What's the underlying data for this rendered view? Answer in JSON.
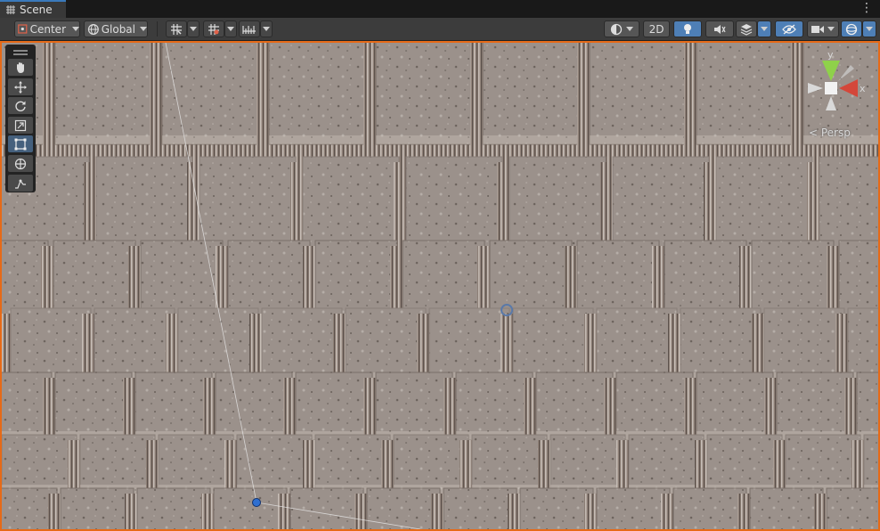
{
  "window": {
    "tab_title": "Scene",
    "menu_icon": "kebab-icon"
  },
  "toolbar": {
    "pivot_label": "Center",
    "space_label": "Global",
    "mode_2d_label": "2D",
    "icons": [
      "center-pivot-icon",
      "global-space-icon",
      "grid-snap-icon",
      "increment-snap-icon",
      "ruler-icon",
      "shading-mode-icon",
      "lighting-icon",
      "audio-mute-icon",
      "effects-icon",
      "hidden-objects-icon",
      "camera-icon",
      "gizmos-icon"
    ]
  },
  "tools": [
    "view-tool",
    "move-tool",
    "rotate-tool",
    "scale-tool",
    "rect-tool",
    "transform-tool",
    "custom-editor-tool"
  ],
  "gizmo": {
    "x_label": "x",
    "y_label": "y",
    "projection_label": "< Persp"
  },
  "colors": {
    "accent_orange": "#e66a17",
    "selected_blue": "#4e7fb6",
    "axis_x": "#d4473a",
    "axis_y": "#8fd14a",
    "toolbar_bg": "#3c3c3c"
  }
}
